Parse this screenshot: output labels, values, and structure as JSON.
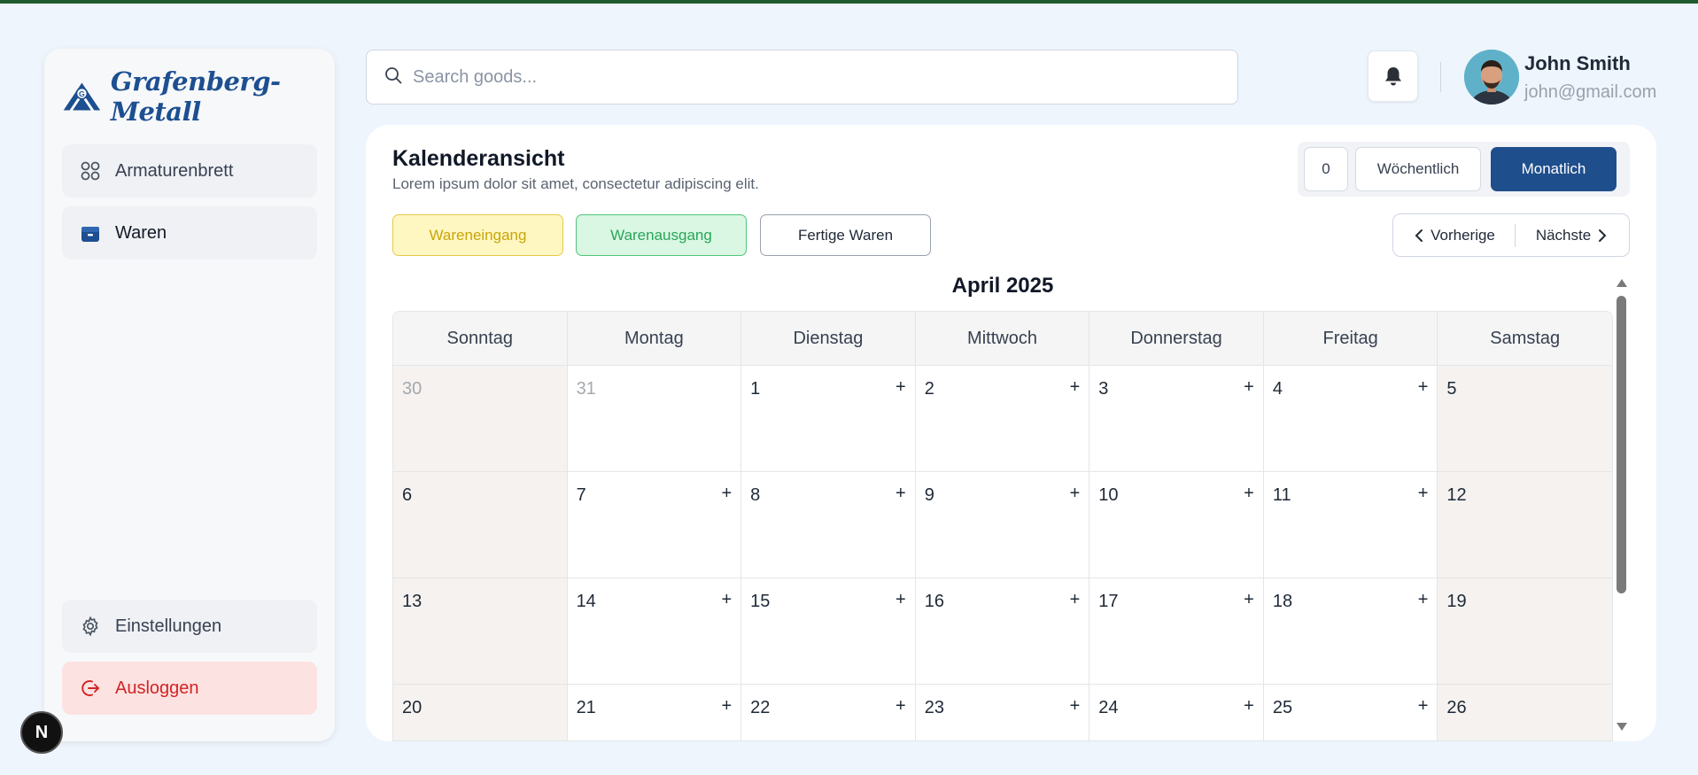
{
  "brand": {
    "name": "Grafenberg-Metall",
    "color": "#1d4f91"
  },
  "sidebar": {
    "items": [
      {
        "label": "Armaturenbrett",
        "icon": "dashboard-grid-icon"
      },
      {
        "label": "Waren",
        "icon": "box-icon"
      }
    ],
    "bottom": [
      {
        "label": "Einstellungen",
        "icon": "gear-icon"
      },
      {
        "label": "Ausloggen",
        "icon": "logout-icon"
      }
    ]
  },
  "search": {
    "placeholder": "Search goods...",
    "value": ""
  },
  "user": {
    "name": "John Smith",
    "email": "john@gmail.com"
  },
  "main": {
    "title": "Kalenderansicht",
    "subtitle": "Lorem ipsum dolor sit amet, consectetur adipiscing elit.",
    "view": {
      "count": "0",
      "weekly": "Wöchentlich",
      "monthly": "Monatlich",
      "active": "monthly"
    },
    "filters": [
      "Wareneingang",
      "Warenausgang",
      "Fertige Waren"
    ],
    "pager": {
      "prev": "Vorherige",
      "next": "Nächste"
    },
    "month_label": "April 2025",
    "weekdays": [
      "Sonntag",
      "Montag",
      "Dienstag",
      "Mittwoch",
      "Donnerstag",
      "Freitag",
      "Samstag"
    ],
    "weeks": [
      [
        {
          "d": "30",
          "other": true
        },
        {
          "d": "31",
          "other": true
        },
        {
          "d": "1",
          "add": true
        },
        {
          "d": "2",
          "add": true
        },
        {
          "d": "3",
          "add": true
        },
        {
          "d": "4",
          "add": true
        },
        {
          "d": "5"
        }
      ],
      [
        {
          "d": "6"
        },
        {
          "d": "7",
          "add": true
        },
        {
          "d": "8",
          "add": true
        },
        {
          "d": "9",
          "add": true
        },
        {
          "d": "10",
          "add": true
        },
        {
          "d": "11",
          "add": true
        },
        {
          "d": "12"
        }
      ],
      [
        {
          "d": "13"
        },
        {
          "d": "14",
          "add": true
        },
        {
          "d": "15",
          "add": true
        },
        {
          "d": "16",
          "add": true
        },
        {
          "d": "17",
          "add": true
        },
        {
          "d": "18",
          "add": true
        },
        {
          "d": "19"
        }
      ],
      [
        {
          "d": "20"
        },
        {
          "d": "21",
          "add": true
        },
        {
          "d": "22",
          "add": true
        },
        {
          "d": "23",
          "add": true
        },
        {
          "d": "24",
          "add": true
        },
        {
          "d": "25",
          "add": true
        },
        {
          "d": "26"
        }
      ]
    ],
    "add_symbol": "+"
  },
  "colors": {
    "accent": "#1f4e8c",
    "topbar": "#1f5a2e",
    "logout": "#d32323"
  },
  "badge": {
    "label": "N"
  }
}
